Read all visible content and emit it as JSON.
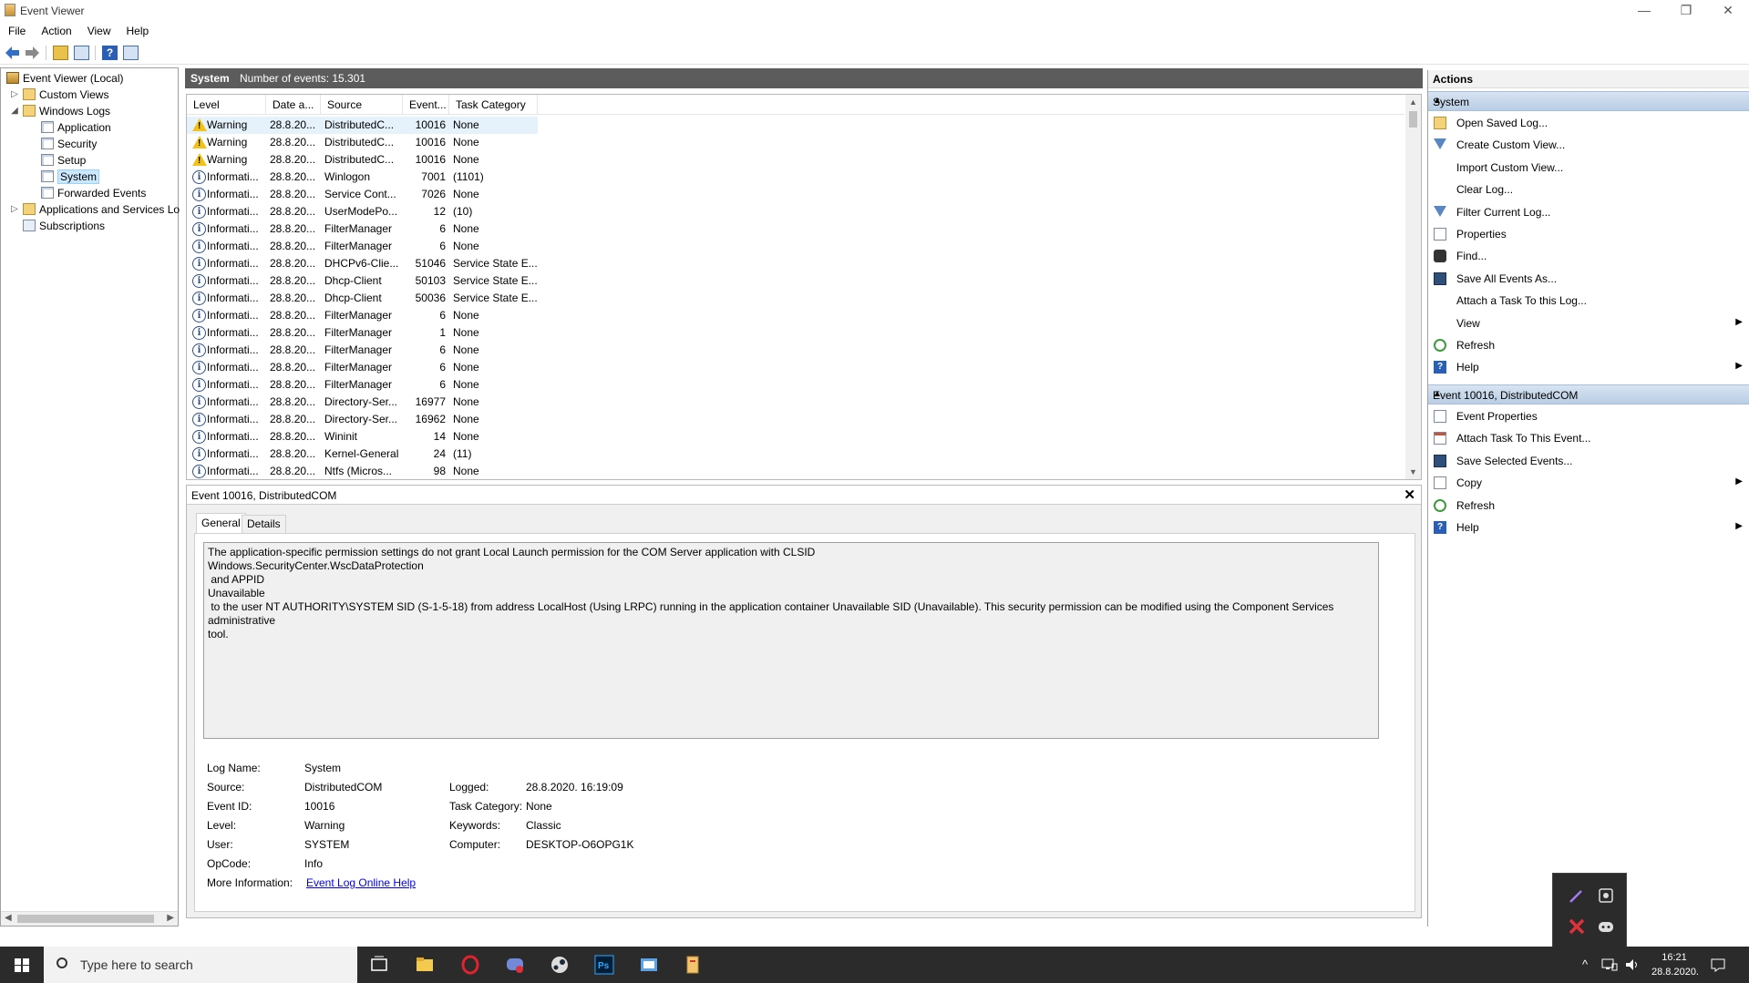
{
  "window": {
    "title": "Event Viewer",
    "min": "—",
    "restore": "❐",
    "close": "✕"
  },
  "menu": [
    "File",
    "Action",
    "View",
    "Help"
  ],
  "tree": {
    "root": "Event Viewer (Local)",
    "custom_views": "Custom Views",
    "windows_logs": "Windows Logs",
    "logs": [
      "Application",
      "Security",
      "Setup",
      "System",
      "Forwarded Events"
    ],
    "apps_services": "Applications and Services Lo",
    "subscriptions": "Subscriptions"
  },
  "center": {
    "log_name": "System",
    "count_text": "Number of events: 15.301"
  },
  "grid": {
    "columns": [
      "Level",
      "Date a...",
      "Source",
      "Event...",
      "Task Category"
    ],
    "rows": [
      {
        "level": "Warning",
        "date": "28.8.20...",
        "source": "DistributedC...",
        "event": "10016",
        "task": "None",
        "type": "warn"
      },
      {
        "level": "Warning",
        "date": "28.8.20...",
        "source": "DistributedC...",
        "event": "10016",
        "task": "None",
        "type": "warn"
      },
      {
        "level": "Warning",
        "date": "28.8.20...",
        "source": "DistributedC...",
        "event": "10016",
        "task": "None",
        "type": "warn"
      },
      {
        "level": "Informati...",
        "date": "28.8.20...",
        "source": "Winlogon",
        "event": "7001",
        "task": "(1101)",
        "type": "info"
      },
      {
        "level": "Informati...",
        "date": "28.8.20...",
        "source": "Service Cont...",
        "event": "7026",
        "task": "None",
        "type": "info"
      },
      {
        "level": "Informati...",
        "date": "28.8.20...",
        "source": "UserModePo...",
        "event": "12",
        "task": "(10)",
        "type": "info"
      },
      {
        "level": "Informati...",
        "date": "28.8.20...",
        "source": "FilterManager",
        "event": "6",
        "task": "None",
        "type": "info"
      },
      {
        "level": "Informati...",
        "date": "28.8.20...",
        "source": "FilterManager",
        "event": "6",
        "task": "None",
        "type": "info"
      },
      {
        "level": "Informati...",
        "date": "28.8.20...",
        "source": "DHCPv6-Clie...",
        "event": "51046",
        "task": "Service State E...",
        "type": "info"
      },
      {
        "level": "Informati...",
        "date": "28.8.20...",
        "source": "Dhcp-Client",
        "event": "50103",
        "task": "Service State E...",
        "type": "info"
      },
      {
        "level": "Informati...",
        "date": "28.8.20...",
        "source": "Dhcp-Client",
        "event": "50036",
        "task": "Service State E...",
        "type": "info"
      },
      {
        "level": "Informati...",
        "date": "28.8.20...",
        "source": "FilterManager",
        "event": "6",
        "task": "None",
        "type": "info"
      },
      {
        "level": "Informati...",
        "date": "28.8.20...",
        "source": "FilterManager",
        "event": "1",
        "task": "None",
        "type": "info"
      },
      {
        "level": "Informati...",
        "date": "28.8.20...",
        "source": "FilterManager",
        "event": "6",
        "task": "None",
        "type": "info"
      },
      {
        "level": "Informati...",
        "date": "28.8.20...",
        "source": "FilterManager",
        "event": "6",
        "task": "None",
        "type": "info"
      },
      {
        "level": "Informati...",
        "date": "28.8.20...",
        "source": "FilterManager",
        "event": "6",
        "task": "None",
        "type": "info"
      },
      {
        "level": "Informati...",
        "date": "28.8.20...",
        "source": "Directory-Ser...",
        "event": "16977",
        "task": "None",
        "type": "info"
      },
      {
        "level": "Informati...",
        "date": "28.8.20...",
        "source": "Directory-Ser...",
        "event": "16962",
        "task": "None",
        "type": "info"
      },
      {
        "level": "Informati...",
        "date": "28.8.20...",
        "source": "Wininit",
        "event": "14",
        "task": "None",
        "type": "info"
      },
      {
        "level": "Informati...",
        "date": "28.8.20...",
        "source": "Kernel-General",
        "event": "24",
        "task": "(11)",
        "type": "info"
      },
      {
        "level": "Informati...",
        "date": "28.8.20...",
        "source": "Ntfs (Micros...",
        "event": "98",
        "task": "None",
        "type": "info"
      }
    ]
  },
  "detail": {
    "title": "Event 10016, DistributedCOM",
    "close": "✕",
    "tabs": [
      "General",
      "Details"
    ],
    "description": "The application-specific permission settings do not grant Local Launch permission for the COM Server application with CLSID\nWindows.SecurityCenter.WscDataProtection\n and APPID\nUnavailable\n to the user NT AUTHORITY\\SYSTEM SID (S-1-5-18) from address LocalHost (Using LRPC) running in the application container Unavailable SID (Unavailable). This security permission can be modified using the Component Services administrative\ntool.",
    "labels": {
      "log_name": "Log Name:",
      "source": "Source:",
      "event_id": "Event ID:",
      "level": "Level:",
      "user": "User:",
      "opcode": "OpCode:",
      "more_info": "More Information:",
      "logged": "Logged:",
      "task_category": "Task Category:",
      "keywords": "Keywords:",
      "computer": "Computer:"
    },
    "values": {
      "log_name": "System",
      "source": "DistributedCOM",
      "event_id": "10016",
      "level": "Warning",
      "user": "SYSTEM",
      "opcode": "Info",
      "more_info_link": "Event Log Online Help",
      "logged": "28.8.2020. 16:19:09",
      "task_category": "None",
      "keywords": "Classic",
      "computer": "DESKTOP-O6OPG1K"
    }
  },
  "actions": {
    "title": "Actions",
    "section1": "System",
    "items1": [
      {
        "label": "Open Saved Log...",
        "icon": "open"
      },
      {
        "label": "Create Custom View...",
        "icon": "filter"
      },
      {
        "label": "Import Custom View...",
        "icon": "none"
      },
      {
        "label": "Clear Log...",
        "icon": "none"
      },
      {
        "label": "Filter Current Log...",
        "icon": "filter"
      },
      {
        "label": "Properties",
        "icon": "doc"
      },
      {
        "label": "Find...",
        "icon": "find"
      },
      {
        "label": "Save All Events As...",
        "icon": "save"
      },
      {
        "label": "Attach a Task To this Log...",
        "icon": "none"
      },
      {
        "label": "View",
        "icon": "none",
        "submenu": true
      },
      {
        "label": "Refresh",
        "icon": "refresh"
      },
      {
        "label": "Help",
        "icon": "help",
        "submenu": true
      }
    ],
    "section2": "Event 10016, DistributedCOM",
    "items2": [
      {
        "label": "Event Properties",
        "icon": "doc"
      },
      {
        "label": "Attach Task To This Event...",
        "icon": "task"
      },
      {
        "label": "Save Selected Events...",
        "icon": "save"
      },
      {
        "label": "Copy",
        "icon": "doc",
        "submenu": true
      },
      {
        "label": "Refresh",
        "icon": "refresh"
      },
      {
        "label": "Help",
        "icon": "help",
        "submenu": true
      }
    ]
  },
  "taskbar": {
    "search_placeholder": "Type here to search",
    "time": "16:21",
    "date": "28.8.2020."
  },
  "colors": {
    "header_dark": "#5c5c5c",
    "section_blue": "#c6d8ec",
    "taskbar": "#2b2b2b",
    "selected_row": "#e5f1fb"
  }
}
